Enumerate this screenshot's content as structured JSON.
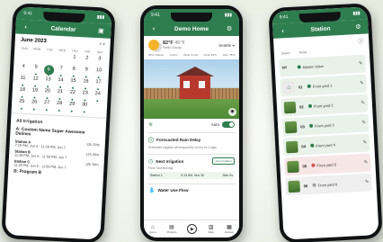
{
  "colors": {
    "brand": "#2e7d4f",
    "warn": "#d9534f",
    "idle": "#9e9e9e"
  },
  "calendar_screen": {
    "time": "9:41",
    "title": "Calendar",
    "month": "June 2023",
    "dow": [
      "SUN",
      "MON",
      "TUE",
      "WED",
      "THU",
      "FRI",
      "SAT"
    ],
    "days": [
      "",
      "",
      "",
      "",
      "1",
      "2",
      "3",
      "4",
      "5",
      "6",
      "7",
      "8",
      "9",
      "10",
      "11",
      "12",
      "13",
      "14",
      "15",
      "16",
      "17",
      "18",
      "19",
      "20",
      "21",
      "22",
      "23",
      "24",
      "25",
      "26",
      "27",
      "28",
      "29",
      "30",
      ""
    ],
    "selected_day": "6",
    "section": "All Irrigation",
    "program": "A: Custom Name Super Awesome Delines",
    "zones": [
      {
        "name": "Station A",
        "detail": "7:19 PM, Jun 6 - 11:29 PM, Jun 7",
        "dur": "12h 30m"
      },
      {
        "name": "Station B",
        "detail": "11:29 PM, Jun 6 - 11:59 PM, Jun 7",
        "dur": "12h 30m"
      },
      {
        "name": "Station C",
        "detail": "11:29 PM, Jun 6 - 11:59 PM, Jun 7",
        "dur": "12h 30m"
      }
    ],
    "program2": "B: Program B"
  },
  "home_screen": {
    "time": "9:41",
    "title": "Demo Home",
    "temp_high": "82°F",
    "temp_low": "45°F",
    "condition": "Partly Cloudy",
    "location": "Seattle",
    "stats": [
      "40% Chance",
      "0.23 in",
      "Wind 4 mph",
      "Temp 64°F",
      "Hum 78%"
    ],
    "auto_label": "Auto",
    "forecast_title": "Forecasted Rain Delay",
    "forecast_text": "Scheduled irrigation will temporarily not run for 2 days",
    "next_title": "Next Irrigation",
    "next_pill": "Auto Irrigation",
    "next_sub": "Front Yard Morning",
    "next_row": {
      "station": "Station 1",
      "time": "9:13 AM, Nov 30",
      "dur": "36m 0s"
    },
    "water_title": "Water Use Flow",
    "tabs": [
      "Home",
      "Program",
      "",
      "Stats",
      "Devices"
    ]
  },
  "stations_screen": {
    "time": "9:41",
    "title": "Station",
    "col_headers": [
      "Station",
      "Name"
    ],
    "rows": [
      {
        "num": "MV",
        "name": "Master Valve",
        "status": "on",
        "thumb": "mv"
      },
      {
        "num": "01",
        "name": "Front yard 1",
        "status": "on",
        "thumb": "house"
      },
      {
        "num": "02",
        "name": "Front yard 2",
        "status": "on",
        "thumb": "grass"
      },
      {
        "num": "03",
        "name": "Front yard 3",
        "status": "on",
        "thumb": "grass"
      },
      {
        "num": "04",
        "name": "Front yard 4",
        "status": "on",
        "thumb": "grass"
      },
      {
        "num": "05",
        "name": "Front yard 5",
        "status": "off",
        "thumb": "grass"
      },
      {
        "num": "06",
        "name": "Front yard 6",
        "status": "idle",
        "thumb": "grass"
      }
    ]
  }
}
